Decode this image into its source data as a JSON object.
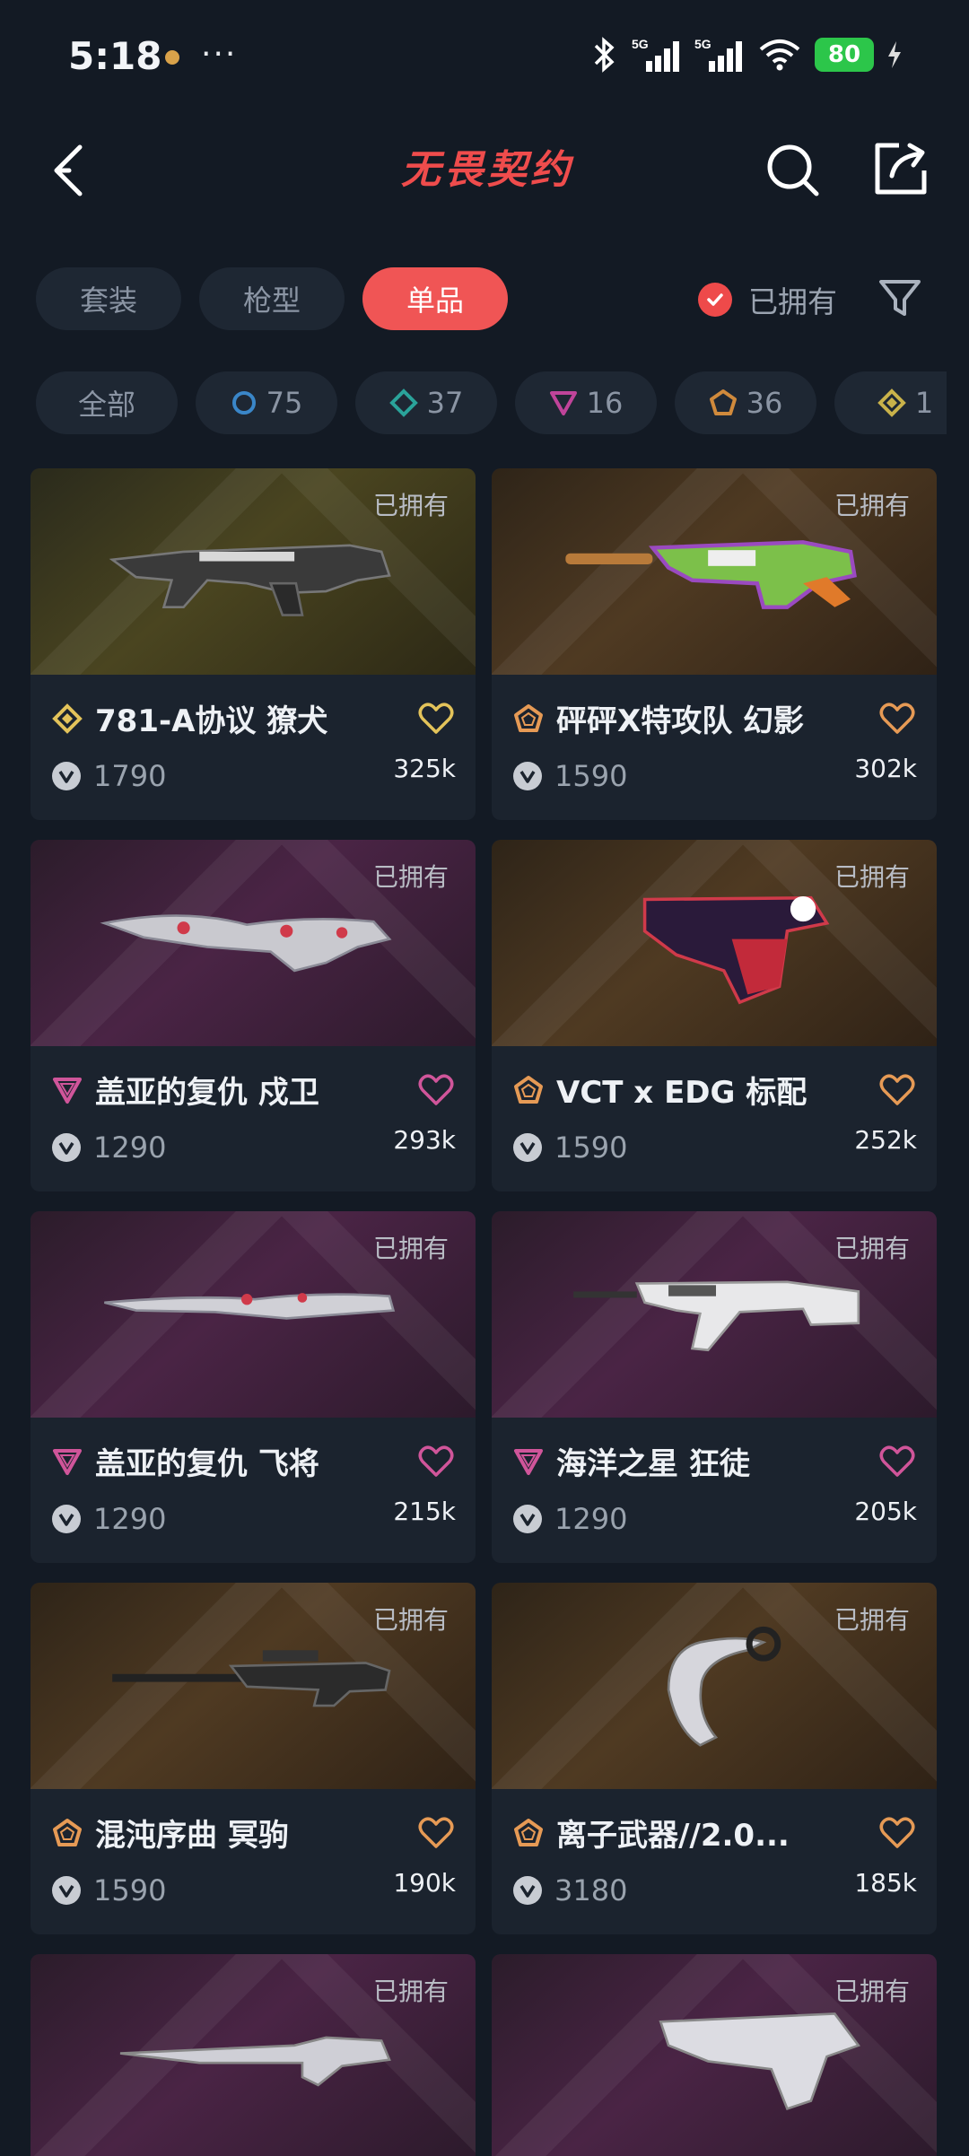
{
  "status": {
    "time": "5:18",
    "ellipsis": "···",
    "signal1": "5G",
    "signal2": "5G",
    "battery": "80"
  },
  "header": {
    "logo_text": "无畏契约"
  },
  "tabs": [
    {
      "label": "套装",
      "active": false
    },
    {
      "label": "枪型",
      "active": false
    },
    {
      "label": "单品",
      "active": true
    }
  ],
  "owned_toggle": {
    "label": "已拥有",
    "checked": true
  },
  "rarity_filters": [
    {
      "label": "全部",
      "icon": "none",
      "color": ""
    },
    {
      "label": "75",
      "icon": "circle-icon",
      "color": "#3a86c8"
    },
    {
      "label": "37",
      "icon": "diamond-icon",
      "color": "#2aa39a"
    },
    {
      "label": "16",
      "icon": "triangle-down-icon",
      "color": "#c0449a"
    },
    {
      "label": "36",
      "icon": "pentagon-icon",
      "color": "#d08a3c"
    },
    {
      "label": "1",
      "icon": "diamond-gold-icon",
      "color": "#c9b24a"
    }
  ],
  "colors": {
    "accent": "#f05555",
    "gold_tier": "#e3c35a",
    "orange_tier": "#e69a55",
    "pink_tier": "#d0559a"
  },
  "cards": [
    {
      "owned_tag": "已拥有",
      "name": "781-A协议 獠犬",
      "price": "1790",
      "likes": "325k",
      "tier": "gold",
      "bg": "gold"
    },
    {
      "owned_tag": "已拥有",
      "name": "砰砰X特攻队 幻影",
      "price": "1590",
      "likes": "302k",
      "tier": "orange",
      "bg": "orange"
    },
    {
      "owned_tag": "已拥有",
      "name": "盖亚的复仇 戍卫",
      "price": "1290",
      "likes": "293k",
      "tier": "pink",
      "bg": "purple"
    },
    {
      "owned_tag": "已拥有",
      "name": "VCT x EDG 标配",
      "price": "1590",
      "likes": "252k",
      "tier": "orange",
      "bg": "orange"
    },
    {
      "owned_tag": "已拥有",
      "name": "盖亚的复仇 飞将",
      "price": "1290",
      "likes": "215k",
      "tier": "pink",
      "bg": "purple"
    },
    {
      "owned_tag": "已拥有",
      "name": "海洋之星 狂徒",
      "price": "1290",
      "likes": "205k",
      "tier": "pink",
      "bg": "purple"
    },
    {
      "owned_tag": "已拥有",
      "name": "混沌序曲 冥驹",
      "price": "1590",
      "likes": "190k",
      "tier": "orange",
      "bg": "orange"
    },
    {
      "owned_tag": "已拥有",
      "name": "离子武器//2.0...",
      "price": "3180",
      "likes": "185k",
      "tier": "orange",
      "bg": "orange"
    },
    {
      "owned_tag": "已拥有",
      "name": "",
      "price": "",
      "likes": "",
      "tier": "",
      "bg": "purple"
    },
    {
      "owned_tag": "已拥有",
      "name": "",
      "price": "",
      "likes": "",
      "tier": "",
      "bg": "purple"
    }
  ]
}
